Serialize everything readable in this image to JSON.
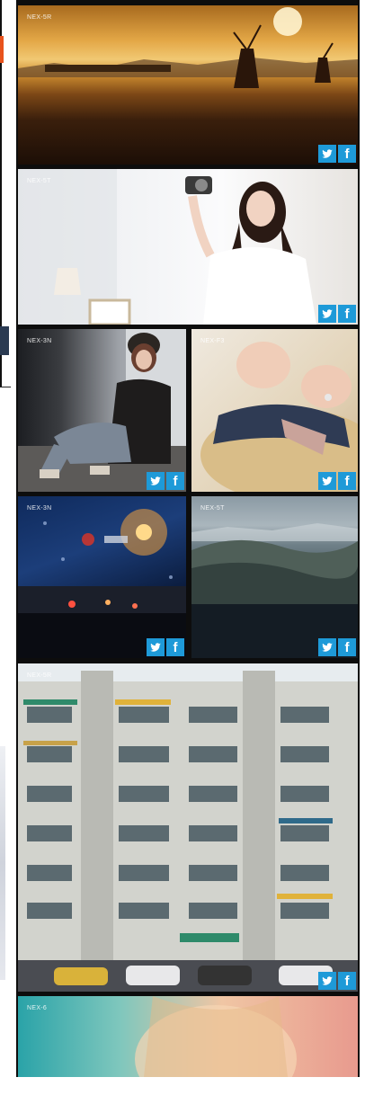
{
  "photos": [
    {
      "label": "NEX-5R",
      "scene": "sunset windmills"
    },
    {
      "label": "NEX-5T",
      "scene": "woman with camera"
    },
    {
      "label": "NEX-3N",
      "scene": "girl sitting"
    },
    {
      "label": "NEX-F3",
      "scene": "straw hat"
    },
    {
      "label": "NEX-3N",
      "scene": "rainy night street"
    },
    {
      "label": "NEX-5T",
      "scene": "aerial mountains"
    },
    {
      "label": "NEX-5R",
      "scene": "apartment building"
    },
    {
      "label": "NEX-6",
      "scene": "portrait blur"
    }
  ],
  "share": {
    "twitter_icon": "twitter-icon",
    "facebook_label": "f"
  },
  "colors": {
    "share_bg": "#1e9ad8",
    "frame": "#0d0d0d"
  }
}
